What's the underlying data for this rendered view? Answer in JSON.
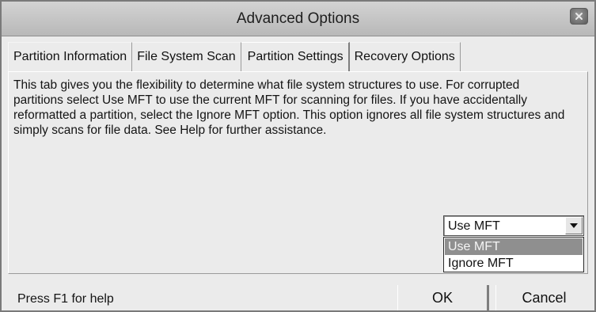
{
  "window": {
    "title": "Advanced Options",
    "close_icon": "close-icon"
  },
  "tabs": [
    {
      "label": "Partition Information",
      "active": false
    },
    {
      "label": "File System Scan",
      "active": false
    },
    {
      "label": "Partition Settings",
      "active": true
    },
    {
      "label": "Recovery Options",
      "active": false
    }
  ],
  "panel": {
    "description": "This tab gives you the flexibility to determine what file system structures to use. For corrupted partitions select Use MFT to use the current MFT for scanning for files. If you have accidentally reformatted a partition, select the Ignore MFT option. This option ignores all file system structures and simply scans for file data. See Help for further assistance.",
    "mft_select": {
      "value": "Use MFT",
      "arrow_icon": "chevron-down-icon",
      "options": [
        "Use MFT",
        "Ignore MFT"
      ],
      "highlighted": "Use MFT"
    }
  },
  "footer": {
    "help": "Press F1 for help",
    "ok_label": "OK",
    "cancel_label": "Cancel"
  }
}
